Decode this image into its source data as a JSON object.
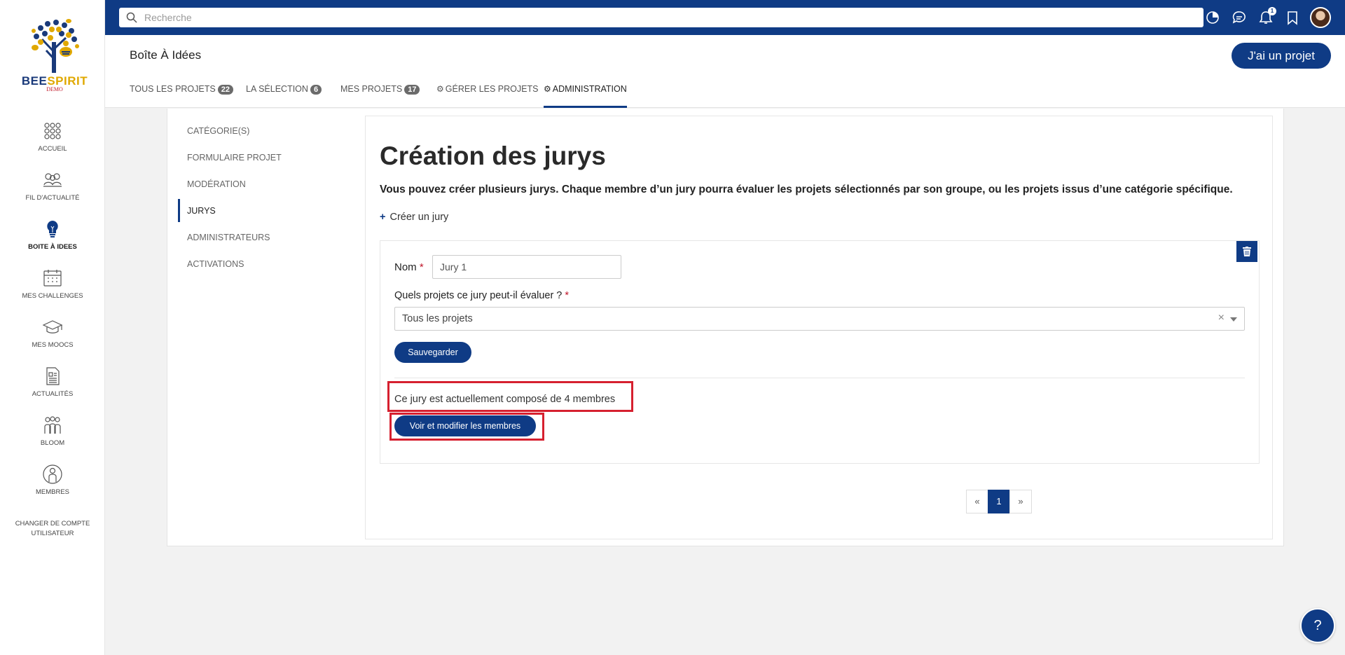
{
  "brand": {
    "name_part1": "BEE",
    "name_part2": "SPIRIT",
    "tag": "DEMO"
  },
  "search": {
    "placeholder": "Recherche"
  },
  "topbar": {
    "notif_count": "1"
  },
  "sidebar": {
    "items": [
      {
        "label": "ACCUEIL",
        "icon": "grid-dots-icon"
      },
      {
        "label": "FIL D'ACTUALITÉ",
        "icon": "people-feed-icon"
      },
      {
        "label": "BOITE À IDEES",
        "icon": "lightbulb-icon",
        "active": true
      },
      {
        "label": "MES CHALLENGES",
        "icon": "calendar-icon"
      },
      {
        "label": "MES MOOCS",
        "icon": "graduation-cap-icon"
      },
      {
        "label": "ACTUALITÉS",
        "icon": "newspaper-icon"
      },
      {
        "label": "BLOOM",
        "icon": "group-icon"
      },
      {
        "label": "MEMBRES",
        "icon": "person-icon"
      }
    ],
    "switch_account": {
      "line1": "CHANGER DE COMPTE",
      "line2": "UTILISATEUR"
    }
  },
  "header": {
    "title": "Boîte À Idées",
    "cta": "J'ai un projet",
    "tabs": [
      {
        "label": "TOUS LES PROJETS",
        "badge": "22"
      },
      {
        "label": "LA SÉLECTION",
        "badge": "6"
      },
      {
        "label": "MES PROJETS",
        "badge": "17"
      },
      {
        "label": "GÉRER LES PROJETS"
      },
      {
        "label": "ADMINISTRATION",
        "active": true
      }
    ]
  },
  "subnav": {
    "items": [
      "CATÉGORIE(S)",
      "FORMULAIRE PROJET",
      "MODÉRATION",
      "JURYS",
      "ADMINISTRATEURS",
      "ACTIVATIONS"
    ],
    "active": "JURYS"
  },
  "main": {
    "heading": "Création des jurys",
    "description": "Vous pouvez créer plusieurs jurys. Chaque membre d’un jury pourra évaluer les projets sélectionnés par son groupe, ou les projets issus d’une catégorie spécifique.",
    "create_link": "Créer un jury",
    "jury": {
      "name_label": "Nom",
      "name_value": "Jury 1",
      "projects_label": "Quels projets ce jury peut-il évaluer ?",
      "projects_value": "Tous les projets",
      "save_label": "Sauvegarder",
      "members_text": "Ce jury est actuellement composé de 4 membres",
      "members_button": "Voir et modifier les membres"
    },
    "pagination": {
      "prev": "«",
      "current": "1",
      "next": "»"
    }
  },
  "help": {
    "label": "?"
  },
  "colors": {
    "primary": "#0f3b85",
    "highlight": "#d6202f",
    "required": "#c0162a"
  }
}
